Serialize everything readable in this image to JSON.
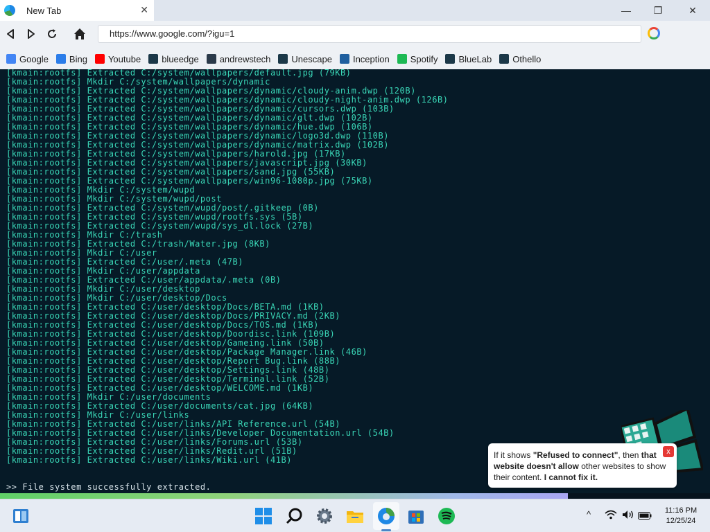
{
  "browser": {
    "tab_title": "New Tab",
    "tab_close": "✕",
    "minimize": "—",
    "restore": "❐",
    "close": "✕",
    "url": "https://www.google.com/?igu=1"
  },
  "bookmarks": [
    {
      "label": "Google",
      "icon": "google-icon",
      "color": "#4285f4"
    },
    {
      "label": "Bing",
      "icon": "bing-icon",
      "color": "#2b7de9"
    },
    {
      "label": "Youtube",
      "icon": "youtube-icon",
      "color": "#ff0000"
    },
    {
      "label": "blueedge",
      "icon": "gear-icon",
      "color": "#1b3848"
    },
    {
      "label": "andrewstech",
      "icon": "andrewstech-icon",
      "color": "#2b3a4a"
    },
    {
      "label": "Unescape",
      "icon": "gear-icon",
      "color": "#1b3848"
    },
    {
      "label": "Inception",
      "icon": "inception-icon",
      "color": "#1f5f9f"
    },
    {
      "label": "Spotify",
      "icon": "spotify-icon",
      "color": "#1db954"
    },
    {
      "label": "BlueLab",
      "icon": "gear-icon",
      "color": "#1b3848"
    },
    {
      "label": "Othello",
      "icon": "gear-icon",
      "color": "#1b3848"
    }
  ],
  "terminal": {
    "lines": [
      "[kmain:rootfs] Extracted C:/system/wallpapers/default.jpg (79KB)",
      "[kmain:rootfs] Mkdir C:/system/wallpapers/dynamic",
      "[kmain:rootfs] Extracted C:/system/wallpapers/dynamic/cloudy-anim.dwp (120B)",
      "[kmain:rootfs] Extracted C:/system/wallpapers/dynamic/cloudy-night-anim.dwp (126B)",
      "[kmain:rootfs] Extracted C:/system/wallpapers/dynamic/cursors.dwp (103B)",
      "[kmain:rootfs] Extracted C:/system/wallpapers/dynamic/glt.dwp (102B)",
      "[kmain:rootfs] Extracted C:/system/wallpapers/dynamic/hue.dwp (106B)",
      "[kmain:rootfs] Extracted C:/system/wallpapers/dynamic/logo3d.dwp (110B)",
      "[kmain:rootfs] Extracted C:/system/wallpapers/dynamic/matrix.dwp (102B)",
      "[kmain:rootfs] Extracted C:/system/wallpapers/harold.jpg (17KB)",
      "[kmain:rootfs] Extracted C:/system/wallpapers/javascript.jpg (30KB)",
      "[kmain:rootfs] Extracted C:/system/wallpapers/sand.jpg (55KB)",
      "[kmain:rootfs] Extracted C:/system/wallpapers/win96-1080p.jpg (75KB)",
      "[kmain:rootfs] Mkdir C:/system/wupd",
      "[kmain:rootfs] Mkdir C:/system/wupd/post",
      "[kmain:rootfs] Extracted C:/system/wupd/post/.gitkeep (0B)",
      "[kmain:rootfs] Extracted C:/system/wupd/rootfs.sys (5B)",
      "[kmain:rootfs] Extracted C:/system/wupd/sys_dl.lock (27B)",
      "[kmain:rootfs] Mkdir C:/trash",
      "[kmain:rootfs] Extracted C:/trash/Water.jpg (8KB)",
      "[kmain:rootfs] Mkdir C:/user",
      "[kmain:rootfs] Extracted C:/user/.meta (47B)",
      "[kmain:rootfs] Mkdir C:/user/appdata",
      "[kmain:rootfs] Extracted C:/user/appdata/.meta (0B)",
      "[kmain:rootfs] Mkdir C:/user/desktop",
      "[kmain:rootfs] Mkdir C:/user/desktop/Docs",
      "[kmain:rootfs] Extracted C:/user/desktop/Docs/BETA.md (1KB)",
      "[kmain:rootfs] Extracted C:/user/desktop/Docs/PRIVACY.md (2KB)",
      "[kmain:rootfs] Extracted C:/user/desktop/Docs/TOS.md (1KB)",
      "[kmain:rootfs] Extracted C:/user/desktop/Doordisc.link (109B)",
      "[kmain:rootfs] Extracted C:/user/desktop/Gameing.link (50B)",
      "[kmain:rootfs] Extracted C:/user/desktop/Package Manager.link (46B)",
      "[kmain:rootfs] Extracted C:/user/desktop/Report Bug.link (88B)",
      "[kmain:rootfs] Extracted C:/user/desktop/Settings.link (48B)",
      "[kmain:rootfs] Extracted C:/user/desktop/Terminal.link (52B)",
      "[kmain:rootfs] Extracted C:/user/desktop/WELCOME.md (1KB)",
      "[kmain:rootfs] Mkdir C:/user/documents",
      "[kmain:rootfs] Extracted C:/user/documents/cat.jpg (64KB)",
      "[kmain:rootfs] Mkdir C:/user/links",
      "[kmain:rootfs] Extracted C:/user/links/API Reference.url (54B)",
      "[kmain:rootfs] Extracted C:/user/links/Developer Documentation.url (54B)",
      "[kmain:rootfs] Extracted C:/user/links/Forums.url (53B)",
      "[kmain:rootfs] Extracted C:/user/links/Redit.url (51B)",
      "[kmain:rootfs] Extracted C:/user/links/Wiki.url (41B)"
    ],
    "prompt": ">> File system successfully extracted.",
    "text_color": "#3ad8b8",
    "background": "#061a27"
  },
  "progress": {
    "fraction": 0.8
  },
  "tooltip": {
    "part1": "If it shows ",
    "part2": "\"Refused to connect\"",
    "part3": ", then ",
    "part4": "that website doesn't allow",
    "part5": " other websites to show their content. ",
    "part6": "I cannot fix it.",
    "close": "x"
  },
  "taskbar": {
    "icons": [
      "widgets-icon",
      "windows-start-icon",
      "search-icon",
      "settings-icon",
      "file-explorer-icon",
      "edge-icon",
      "store-icon",
      "spotify-icon"
    ],
    "tray_chevron": "^",
    "time": "11:16 PM",
    "date": "12/25/24"
  }
}
